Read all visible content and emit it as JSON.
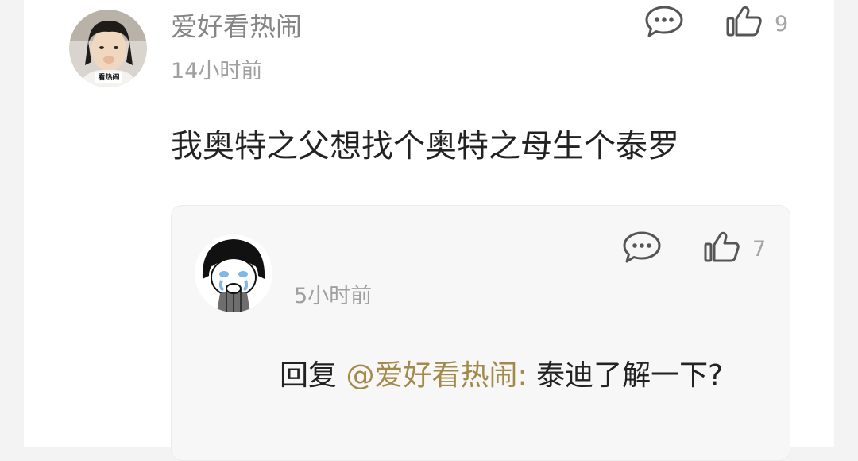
{
  "comment": {
    "username": "爱好看热闹",
    "time": "14小时前",
    "text": "我奥特之父想找个奥特之母生个泰罗",
    "like_count": "9",
    "avatar_caption": "看热闹"
  },
  "reply": {
    "time": "5小时前",
    "prefix": "回复",
    "mention": "@爱好看热闹:",
    "text": "泰迪了解一下?",
    "like_count": "7"
  },
  "icons": {
    "comment": "comment-bubble-icon",
    "like": "thumbs-up-icon"
  },
  "colors": {
    "page_bg": "#f3f3f3",
    "card_bg": "#ffffff",
    "reply_bg": "#f7f7f7",
    "username": "#858585",
    "meta": "#a0a0a0",
    "body_text": "#222222",
    "mention": "#a28a4a",
    "icon": "#555555"
  }
}
